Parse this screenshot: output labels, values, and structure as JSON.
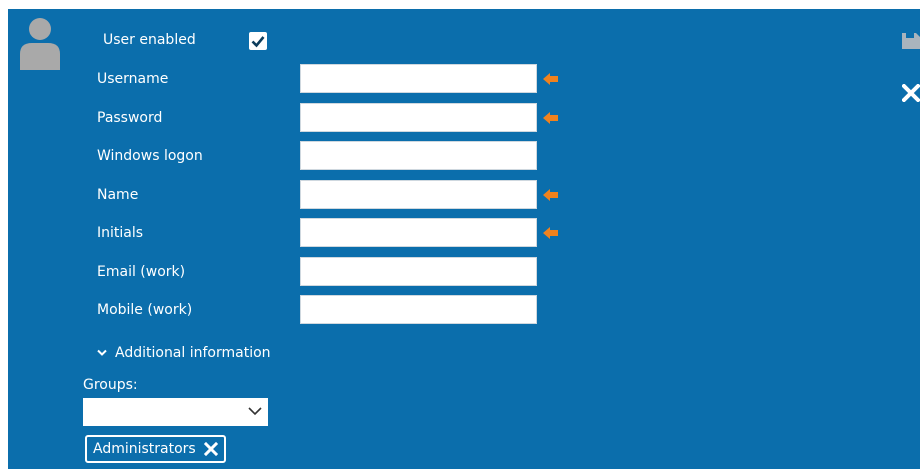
{
  "form": {
    "user_enabled_label": "User enabled",
    "user_enabled_checked": true,
    "fields": [
      {
        "label": "Username",
        "value": "",
        "required": true
      },
      {
        "label": "Password",
        "value": "",
        "required": true
      },
      {
        "label": "Windows logon",
        "value": "",
        "required": false
      },
      {
        "label": "Name",
        "value": "",
        "required": true
      },
      {
        "label": "Initials",
        "value": "",
        "required": true
      },
      {
        "label": "Email (work)",
        "value": "",
        "required": false
      },
      {
        "label": "Mobile (work)",
        "value": "",
        "required": false
      }
    ],
    "additional_info_label": "Additional information",
    "groups_label": "Groups:",
    "groups_select_value": "",
    "groups_selected": [
      "Administrators"
    ]
  },
  "icons": {
    "avatar": "user-avatar-icon",
    "save": "save-icon",
    "close": "close-icon",
    "required": "arrow-left-icon",
    "expand": "chevron-down-icon",
    "dropdown": "chevron-down-icon",
    "remove": "close-icon"
  },
  "colors": {
    "panel": "#0b6eac",
    "required_arrow": "#f0821e",
    "avatar": "#a9a9a9"
  }
}
